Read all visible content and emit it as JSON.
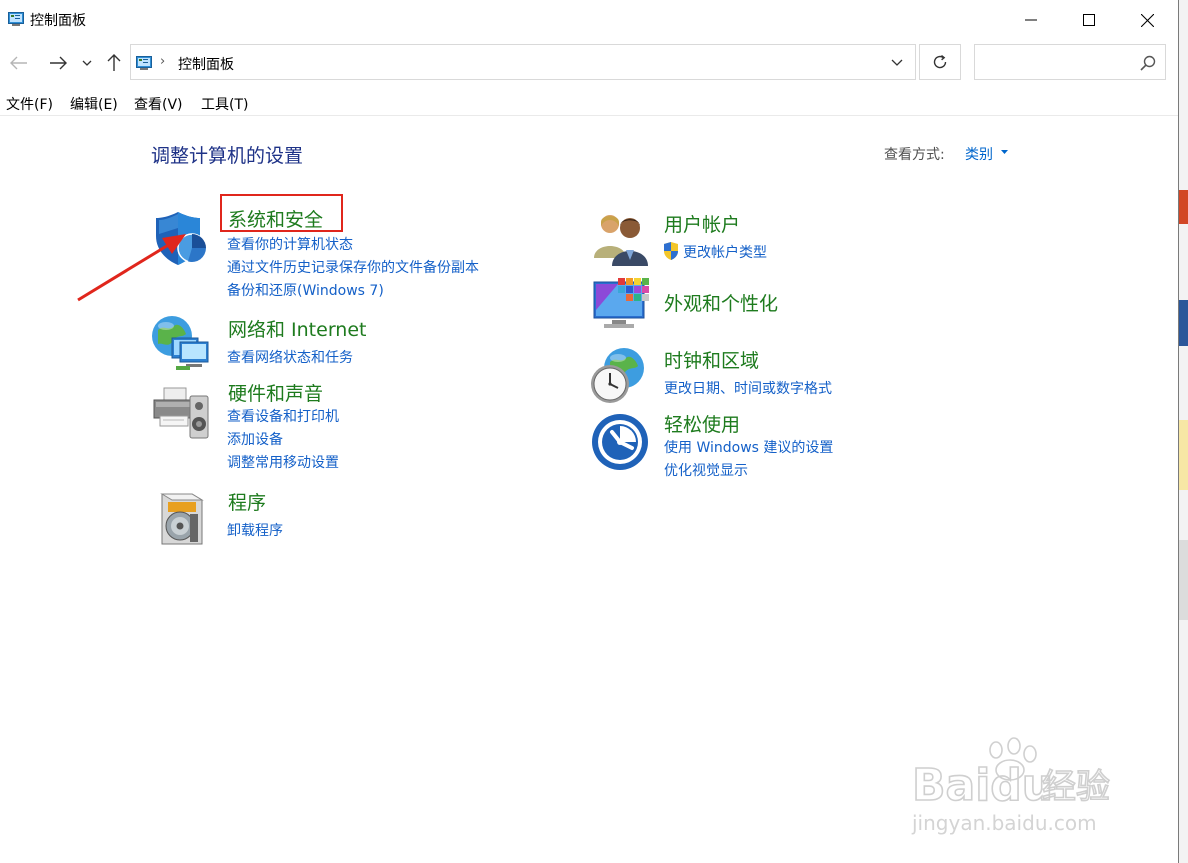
{
  "window": {
    "title": "控制面板"
  },
  "address": {
    "path": "控制面板",
    "separator": "›"
  },
  "search": {
    "placeholder": ""
  },
  "menu": [
    "文件(F)",
    "编辑(E)",
    "查看(V)",
    "工具(T)"
  ],
  "content": {
    "heading": "调整计算机的设置",
    "view_by_label": "查看方式:",
    "view_by_value": "类别"
  },
  "categories": [
    {
      "title": "系统和安全",
      "icon": "shield-icon",
      "links": [
        "查看你的计算机状态",
        "通过文件历史记录保存你的文件备份副本",
        "备份和还原(Windows 7)"
      ]
    },
    {
      "title": "网络和 Internet",
      "icon": "network-globe-icon",
      "links": [
        "查看网络状态和任务"
      ]
    },
    {
      "title": "硬件和声音",
      "icon": "printer-speaker-icon",
      "links": [
        "查看设备和打印机",
        "添加设备",
        "调整常用移动设置"
      ]
    },
    {
      "title": "程序",
      "icon": "programs-disc-icon",
      "links": [
        "卸载程序"
      ]
    },
    {
      "title": "用户帐户",
      "icon": "users-icon",
      "links": [
        "更改帐户类型"
      ]
    },
    {
      "title": "外观和个性化",
      "icon": "monitor-palette-icon",
      "links": []
    },
    {
      "title": "时钟和区域",
      "icon": "clock-globe-icon",
      "links": [
        "更改日期、时间或数字格式"
      ]
    },
    {
      "title": "轻松使用",
      "icon": "ease-of-access-icon",
      "links": [
        "使用 Windows 建议的设置",
        "优化视觉显示"
      ]
    }
  ],
  "watermark": {
    "brand": "Baidu",
    "suffix": "经验",
    "url": "jingyan.baidu.com"
  },
  "colors": {
    "category_title": "#1e7b1e",
    "link": "#1460c8",
    "heading": "#1e3287",
    "highlight": "#e0261c"
  }
}
